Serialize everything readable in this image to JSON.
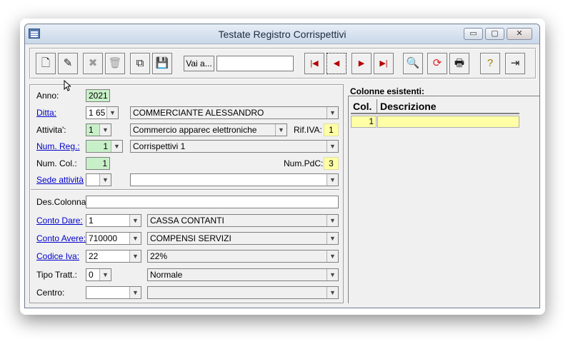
{
  "window": {
    "title": "Testate Registro Corrispettivi",
    "buttons": {
      "minimize": "▭",
      "maximize": "▢",
      "close": "✕"
    }
  },
  "toolbar": {
    "vai_label": "Vai a...",
    "vai_value": "",
    "icons": [
      "new-icon",
      "edit-icon",
      "cancel-icon",
      "delete-icon",
      "copy-icon",
      "save-icon",
      "first-record-icon",
      "previous-record-icon",
      "next-record-icon",
      "last-record-icon",
      "preview-icon",
      "refresh-icon",
      "print-icon",
      "help-icon",
      "exit-icon"
    ]
  },
  "form": {
    "anno": {
      "label": "Anno:",
      "value": "2021"
    },
    "ditta": {
      "label": "Ditta:",
      "code": "1 65",
      "name": "COMMERCIANTE ALESSANDRO"
    },
    "attivita": {
      "label": "Attivita':",
      "code": "1",
      "name": "Commercio apparec elettroniche",
      "rif_iva_label": "Rif.IVA:",
      "rif_iva_value": "1"
    },
    "num_reg": {
      "label": "Num. Reg.:",
      "code": "1",
      "name": "Corrispettivi 1"
    },
    "num_col": {
      "label": "Num. Col.:",
      "value": "1",
      "num_pdc_label": "Num.PdC:",
      "num_pdc_value": "3"
    },
    "sede": {
      "label": "Sede attività",
      "code": "",
      "name": ""
    },
    "des_colonna": {
      "label": "Des.Colonna:",
      "value": ""
    },
    "conto_dare": {
      "label": "Conto Dare:",
      "code": "1",
      "name": "CASSA CONTANTI"
    },
    "conto_avere": {
      "label": "Conto Avere:",
      "code": "710000",
      "name": "COMPENSI SERVIZI"
    },
    "codice_iva": {
      "label": "Codice Iva:",
      "code": "22",
      "name": "22%"
    },
    "tipo_tratt": {
      "label": "Tipo Tratt.:",
      "code": "0",
      "name": "Normale"
    },
    "centro": {
      "label": "Centro:",
      "code": "",
      "name": ""
    }
  },
  "colonne": {
    "title": "Colonne esistenti:",
    "headers": {
      "col": "Col.",
      "descrizione": "Descrizione"
    },
    "rows": [
      {
        "col": "1",
        "descrizione": ""
      }
    ]
  },
  "colors": {
    "required": "#c8f0c8",
    "highlight": "#ffffa6",
    "link": "#0000cc"
  }
}
